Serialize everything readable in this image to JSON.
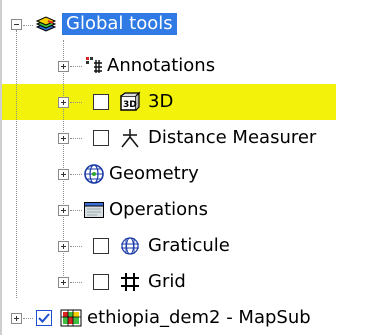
{
  "tree": {
    "root": {
      "label": "Global tools",
      "icon": "layers-stack-icon",
      "selected": true
    },
    "children": [
      {
        "label": "Annotations",
        "icon": "annotations-icon",
        "has_checkbox": false
      },
      {
        "label": "3D",
        "icon": "3d-icon",
        "has_checkbox": true,
        "checked": false,
        "highlighted": true
      },
      {
        "label": "Distance Measurer",
        "icon": "distance-measurer-icon",
        "has_checkbox": true,
        "checked": false
      },
      {
        "label": "Geometry",
        "icon": "geometry-globe-icon",
        "has_checkbox": false
      },
      {
        "label": "Operations",
        "icon": "operations-icon",
        "has_checkbox": false
      },
      {
        "label": "Graticule",
        "icon": "graticule-icon",
        "has_checkbox": true,
        "checked": false
      },
      {
        "label": "Grid",
        "icon": "grid-icon",
        "has_checkbox": true,
        "checked": false
      }
    ],
    "next_root": {
      "label": "ethiopia_dem2 - MapSub",
      "icon": "raster-map-icon",
      "has_checkbox": true,
      "checked": true
    },
    "highlight_color": "#f2f20a",
    "selection_color": "#2f7ae5"
  }
}
